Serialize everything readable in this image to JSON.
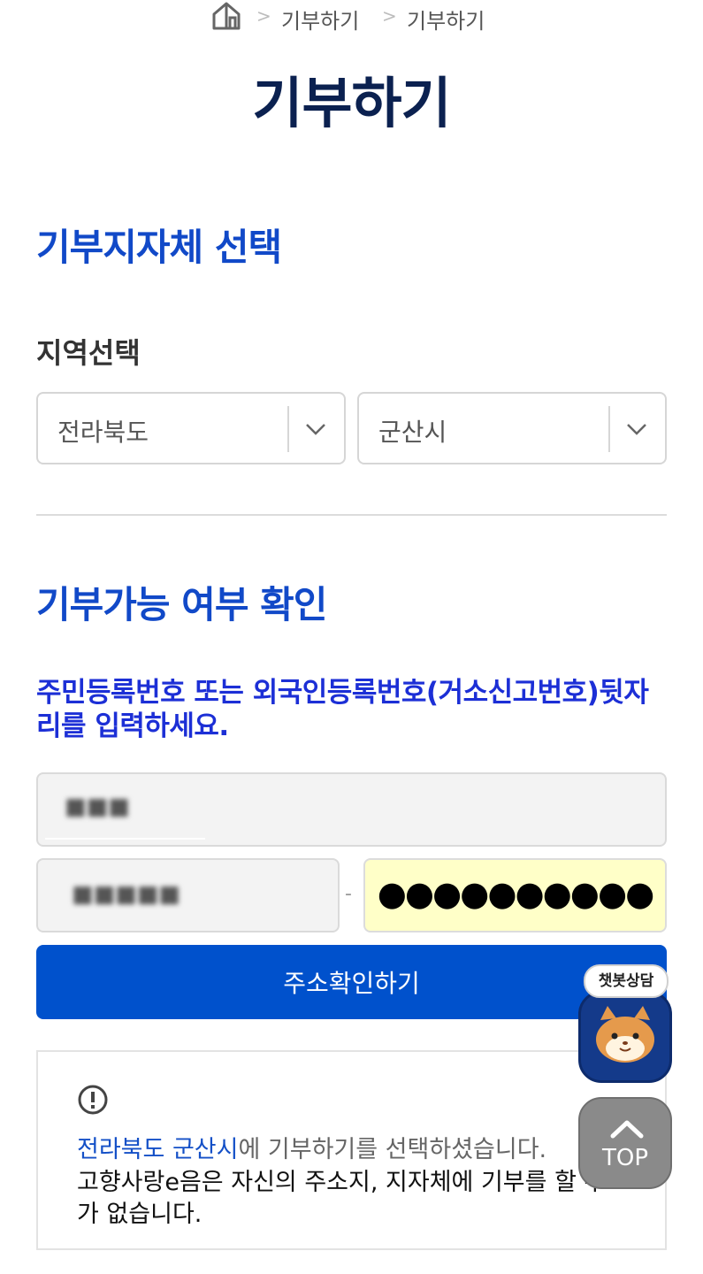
{
  "breadcrumb": {
    "home_icon": "home-icon",
    "items": [
      "기부하기",
      "기부하기"
    ],
    "separator": ">"
  },
  "page_title": "기부하기",
  "section_region": {
    "title": "기부지자체 선택",
    "label": "지역선택",
    "province": "전라북도",
    "city": "군산시"
  },
  "section_check": {
    "title": "기부가능 여부 확인",
    "instruction": "주민등록번호 또는 외국인등록번호(거소신고번호)뒷자리를 입력하세요.",
    "name_value": "■■■",
    "birth_value": "■■■■■",
    "dash": "-",
    "masked_value": "●●●●●●●●●●",
    "address_button": "주소확인하기"
  },
  "info": {
    "alert_icon": "alert-circle-icon",
    "selected_region": "전라북도 군산시",
    "selected_suffix": "에 기부하기를 선택하셨습니다.",
    "message": "고향사랑e음은 자신의 주소지, 지자체에 기부를 할 수가 없습니다."
  },
  "floating": {
    "chatbot_label": "챗봇상담",
    "top_label": "TOP"
  },
  "colors": {
    "title": "#0b2150",
    "section": "#1149c8",
    "instruction": "#1c2fd6",
    "primary_button": "#0051cc",
    "masked_field_bg": "#ffffc8",
    "top_button": "#8a8a8a",
    "chatbot_bg": "#143a8a"
  }
}
